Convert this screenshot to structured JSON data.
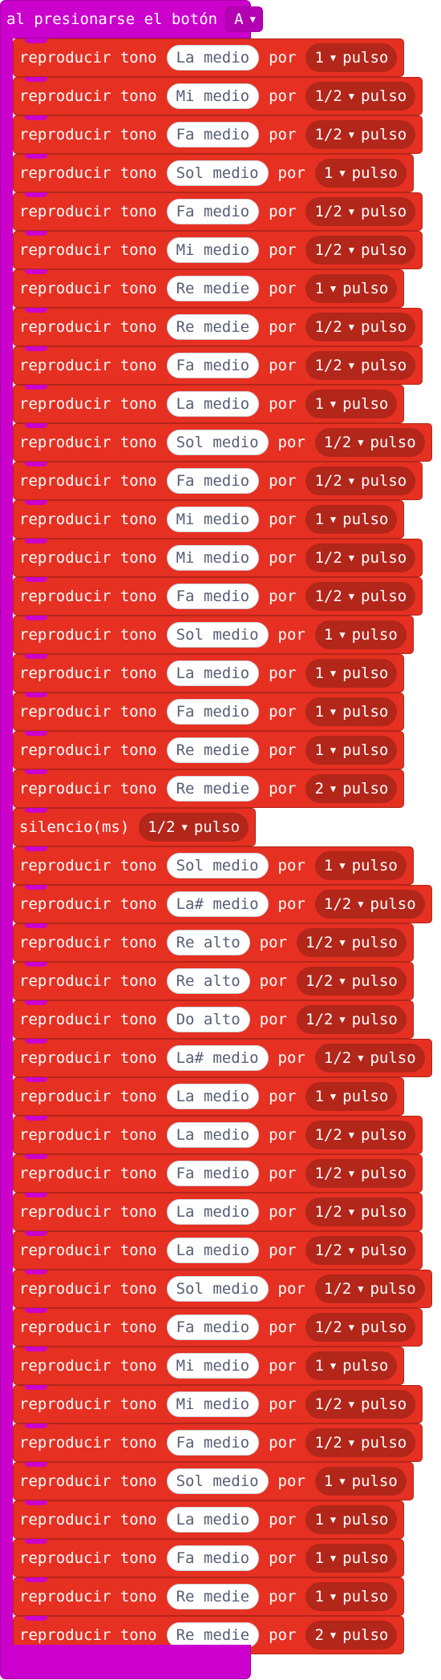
{
  "event": {
    "label": "al presionarse el botón",
    "button_value": "A"
  },
  "labels": {
    "play_tone": "reproducir tono",
    "for": "por",
    "beat_unit": "pulso",
    "rest": "silencio(ms)"
  },
  "colors": {
    "event_block": "#cc00cc",
    "music_block": "#e63022",
    "music_block_dark": "#b3261a",
    "note_pill_text": "#575e75"
  },
  "blocks": [
    {
      "type": "tone",
      "note": "La medio",
      "beats": "1"
    },
    {
      "type": "tone",
      "note": "Mi medio",
      "beats": "1/2"
    },
    {
      "type": "tone",
      "note": "Fa medio",
      "beats": "1/2"
    },
    {
      "type": "tone",
      "note": "Sol medio",
      "beats": "1"
    },
    {
      "type": "tone",
      "note": "Fa medio",
      "beats": "1/2"
    },
    {
      "type": "tone",
      "note": "Mi medio",
      "beats": "1/2"
    },
    {
      "type": "tone",
      "note": "Re medie",
      "beats": "1"
    },
    {
      "type": "tone",
      "note": "Re medie",
      "beats": "1/2"
    },
    {
      "type": "tone",
      "note": "Fa medio",
      "beats": "1/2"
    },
    {
      "type": "tone",
      "note": "La medio",
      "beats": "1"
    },
    {
      "type": "tone",
      "note": "Sol medio",
      "beats": "1/2"
    },
    {
      "type": "tone",
      "note": "Fa medio",
      "beats": "1/2"
    },
    {
      "type": "tone",
      "note": "Mi medio",
      "beats": "1"
    },
    {
      "type": "tone",
      "note": "Mi medio",
      "beats": "1/2"
    },
    {
      "type": "tone",
      "note": "Fa medio",
      "beats": "1/2"
    },
    {
      "type": "tone",
      "note": "Sol medio",
      "beats": "1"
    },
    {
      "type": "tone",
      "note": "La medio",
      "beats": "1"
    },
    {
      "type": "tone",
      "note": "Fa medio",
      "beats": "1"
    },
    {
      "type": "tone",
      "note": "Re medie",
      "beats": "1"
    },
    {
      "type": "tone",
      "note": "Re medie",
      "beats": "2"
    },
    {
      "type": "rest",
      "beats": "1/2"
    },
    {
      "type": "tone",
      "note": "Sol medio",
      "beats": "1"
    },
    {
      "type": "tone",
      "note": "La# medio",
      "beats": "1/2"
    },
    {
      "type": "tone",
      "note": "Re alto",
      "beats": "1/2"
    },
    {
      "type": "tone",
      "note": "Re alto",
      "beats": "1/2"
    },
    {
      "type": "tone",
      "note": "Do alto",
      "beats": "1/2"
    },
    {
      "type": "tone",
      "note": "La# medio",
      "beats": "1/2"
    },
    {
      "type": "tone",
      "note": "La medio",
      "beats": "1"
    },
    {
      "type": "tone",
      "note": "La medio",
      "beats": "1/2"
    },
    {
      "type": "tone",
      "note": "Fa medio",
      "beats": "1/2"
    },
    {
      "type": "tone",
      "note": "La medio",
      "beats": "1/2"
    },
    {
      "type": "tone",
      "note": "La medio",
      "beats": "1/2"
    },
    {
      "type": "tone",
      "note": "Sol medio",
      "beats": "1/2"
    },
    {
      "type": "tone",
      "note": "Fa medio",
      "beats": "1/2"
    },
    {
      "type": "tone",
      "note": "Mi medio",
      "beats": "1"
    },
    {
      "type": "tone",
      "note": "Mi medio",
      "beats": "1/2"
    },
    {
      "type": "tone",
      "note": "Fa medio",
      "beats": "1/2"
    },
    {
      "type": "tone",
      "note": "Sol medio",
      "beats": "1"
    },
    {
      "type": "tone",
      "note": "La medio",
      "beats": "1"
    },
    {
      "type": "tone",
      "note": "Fa medio",
      "beats": "1"
    },
    {
      "type": "tone",
      "note": "Re medie",
      "beats": "1"
    },
    {
      "type": "tone",
      "note": "Re medie",
      "beats": "2"
    }
  ]
}
